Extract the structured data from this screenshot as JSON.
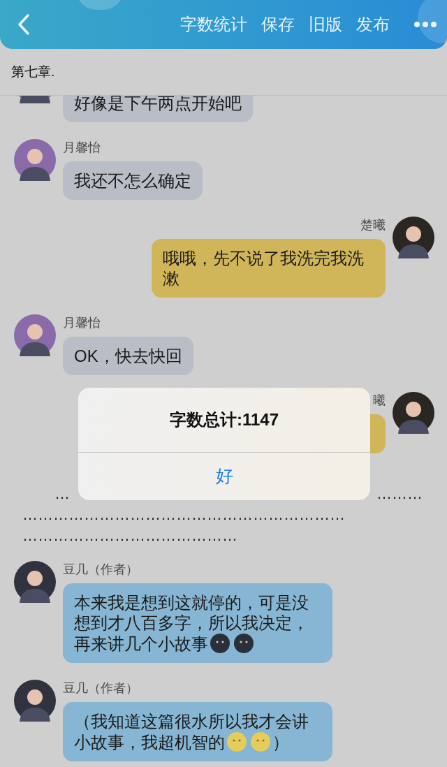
{
  "header": {
    "actions": [
      {
        "label": "字数统计"
      },
      {
        "label": "保存"
      },
      {
        "label": "旧版"
      },
      {
        "label": "发布"
      }
    ]
  },
  "chapter_title": "第七章.",
  "feed": [
    {
      "kind": "message",
      "outgoing": false,
      "parts": [
        {
          "kind": "text",
          "text": "好像是下午两点开始吧"
        }
      ]
    },
    {
      "kind": "message",
      "outgoing": false,
      "name": "月馨怡",
      "parts": [
        {
          "kind": "text",
          "text": "我还不怎么确定"
        }
      ]
    },
    {
      "kind": "message",
      "outgoing": true,
      "name": "楚曦",
      "parts": [
        {
          "kind": "text",
          "text": "哦哦，先不说了我洗完我洗漱"
        }
      ]
    },
    {
      "kind": "message",
      "outgoing": false,
      "name": "月馨怡",
      "parts": [
        {
          "kind": "text",
          "text": "OK，快去快回"
        }
      ]
    },
    {
      "kind": "message",
      "outgoing": true,
      "name": "曦"
    },
    {
      "kind": "dots",
      "lines": [
        {
          "segments": [
            "…",
            "………"
          ]
        },
        {
          "segments": [
            "………………………………………………………"
          ]
        },
        {
          "segments": [
            "……………………………………"
          ]
        }
      ]
    },
    {
      "kind": "message",
      "outgoing": false,
      "name": "豆几（作者）",
      "parts": [
        {
          "kind": "text",
          "text": "本来我是想到这就停的，可是没想到才八百多字，所以我决定，再来讲几个小故事"
        },
        {
          "kind": "new-moon"
        },
        {
          "kind": "new-moon"
        }
      ]
    },
    {
      "kind": "message",
      "outgoing": false,
      "name": "豆几（作者）",
      "parts": [
        {
          "kind": "text",
          "text": "（我知道这篇很水所以我才会讲小故事，我超机智的"
        },
        {
          "kind": "full-moon"
        },
        {
          "kind": "full-moon"
        },
        {
          "kind": "text",
          "text": "）"
        }
      ]
    }
  ],
  "alert": {
    "title": "字数总计:1147",
    "button": "好"
  }
}
